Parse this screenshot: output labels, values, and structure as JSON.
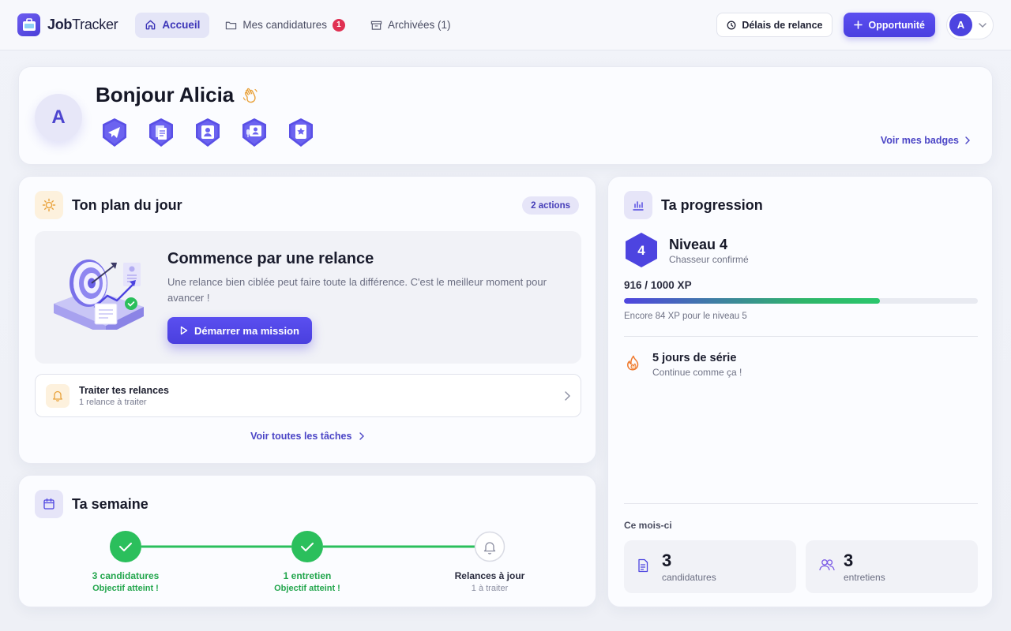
{
  "app": {
    "name_bold": "Job",
    "name_light": "Tracker"
  },
  "nav": {
    "home": "Accueil",
    "applications": "Mes candidatures",
    "applications_count": "1",
    "archived": "Archivées (1)"
  },
  "header": {
    "reminder_delays": "Délais de relance",
    "new_opportunity": "Opportunité",
    "user_initial": "A"
  },
  "hello": {
    "avatar_initial": "A",
    "greeting": "Bonjour Alicia",
    "see_badges": "Voir mes badges",
    "badge_icons": [
      "paper-plane-badge-icon",
      "documents-badge-icon",
      "profile-badge-icon",
      "interview-badge-icon",
      "star-badge-icon"
    ]
  },
  "plan": {
    "title": "Ton plan du jour",
    "actions_pill": "2 actions",
    "mission_title": "Commence par une relance",
    "mission_text": "Une relance bien ciblée peut faire toute la différence. C'est le meilleur moment pour avancer !",
    "mission_button": "Démarrer ma mission",
    "task_title": "Traiter tes relances",
    "task_sub": "1 relance à traiter",
    "see_tasks": "Voir toutes les tâches"
  },
  "week": {
    "title": "Ta semaine",
    "steps": [
      {
        "label": "3 candidatures",
        "sub": "Objectif atteint !",
        "done": true
      },
      {
        "label": "1 entretien",
        "sub": "Objectif atteint !",
        "done": true
      },
      {
        "label": "Relances à jour",
        "sub": "1 à traiter",
        "done": false
      }
    ]
  },
  "progress": {
    "title": "Ta progression",
    "level_num": "4",
    "level_title": "Niveau 4",
    "level_sub": "Chasseur confirmé",
    "xp_text": "916 / 1000 XP",
    "xp_current": 916,
    "xp_max": 1000,
    "xp_left": "Encore 84 XP pour le niveau 5",
    "streak_title": "5 jours de série",
    "streak_sub": "Continue comme ça !",
    "month_label": "Ce mois-ci",
    "stat_applications_num": "3",
    "stat_applications_label": "candidatures",
    "stat_interviews_num": "3",
    "stat_interviews_label": "entretiens"
  },
  "colors": {
    "accent": "#4d44e0",
    "success": "#2bbf5c",
    "danger": "#e03152",
    "warning": "#e9a23b"
  }
}
